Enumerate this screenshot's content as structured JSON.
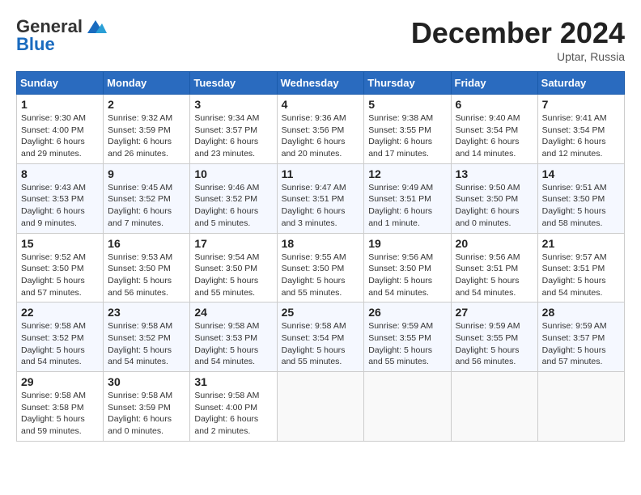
{
  "header": {
    "logo_general": "General",
    "logo_blue": "Blue",
    "month_title": "December 2024",
    "location": "Uptar, Russia"
  },
  "days_of_week": [
    "Sunday",
    "Monday",
    "Tuesday",
    "Wednesday",
    "Thursday",
    "Friday",
    "Saturday"
  ],
  "weeks": [
    [
      {
        "day": "1",
        "detail": "Sunrise: 9:30 AM\nSunset: 4:00 PM\nDaylight: 6 hours\nand 29 minutes."
      },
      {
        "day": "2",
        "detail": "Sunrise: 9:32 AM\nSunset: 3:59 PM\nDaylight: 6 hours\nand 26 minutes."
      },
      {
        "day": "3",
        "detail": "Sunrise: 9:34 AM\nSunset: 3:57 PM\nDaylight: 6 hours\nand 23 minutes."
      },
      {
        "day": "4",
        "detail": "Sunrise: 9:36 AM\nSunset: 3:56 PM\nDaylight: 6 hours\nand 20 minutes."
      },
      {
        "day": "5",
        "detail": "Sunrise: 9:38 AM\nSunset: 3:55 PM\nDaylight: 6 hours\nand 17 minutes."
      },
      {
        "day": "6",
        "detail": "Sunrise: 9:40 AM\nSunset: 3:54 PM\nDaylight: 6 hours\nand 14 minutes."
      },
      {
        "day": "7",
        "detail": "Sunrise: 9:41 AM\nSunset: 3:54 PM\nDaylight: 6 hours\nand 12 minutes."
      }
    ],
    [
      {
        "day": "8",
        "detail": "Sunrise: 9:43 AM\nSunset: 3:53 PM\nDaylight: 6 hours\nand 9 minutes."
      },
      {
        "day": "9",
        "detail": "Sunrise: 9:45 AM\nSunset: 3:52 PM\nDaylight: 6 hours\nand 7 minutes."
      },
      {
        "day": "10",
        "detail": "Sunrise: 9:46 AM\nSunset: 3:52 PM\nDaylight: 6 hours\nand 5 minutes."
      },
      {
        "day": "11",
        "detail": "Sunrise: 9:47 AM\nSunset: 3:51 PM\nDaylight: 6 hours\nand 3 minutes."
      },
      {
        "day": "12",
        "detail": "Sunrise: 9:49 AM\nSunset: 3:51 PM\nDaylight: 6 hours\nand 1 minute."
      },
      {
        "day": "13",
        "detail": "Sunrise: 9:50 AM\nSunset: 3:50 PM\nDaylight: 6 hours\nand 0 minutes."
      },
      {
        "day": "14",
        "detail": "Sunrise: 9:51 AM\nSunset: 3:50 PM\nDaylight: 5 hours\nand 58 minutes."
      }
    ],
    [
      {
        "day": "15",
        "detail": "Sunrise: 9:52 AM\nSunset: 3:50 PM\nDaylight: 5 hours\nand 57 minutes."
      },
      {
        "day": "16",
        "detail": "Sunrise: 9:53 AM\nSunset: 3:50 PM\nDaylight: 5 hours\nand 56 minutes."
      },
      {
        "day": "17",
        "detail": "Sunrise: 9:54 AM\nSunset: 3:50 PM\nDaylight: 5 hours\nand 55 minutes."
      },
      {
        "day": "18",
        "detail": "Sunrise: 9:55 AM\nSunset: 3:50 PM\nDaylight: 5 hours\nand 55 minutes."
      },
      {
        "day": "19",
        "detail": "Sunrise: 9:56 AM\nSunset: 3:50 PM\nDaylight: 5 hours\nand 54 minutes."
      },
      {
        "day": "20",
        "detail": "Sunrise: 9:56 AM\nSunset: 3:51 PM\nDaylight: 5 hours\nand 54 minutes."
      },
      {
        "day": "21",
        "detail": "Sunrise: 9:57 AM\nSunset: 3:51 PM\nDaylight: 5 hours\nand 54 minutes."
      }
    ],
    [
      {
        "day": "22",
        "detail": "Sunrise: 9:58 AM\nSunset: 3:52 PM\nDaylight: 5 hours\nand 54 minutes."
      },
      {
        "day": "23",
        "detail": "Sunrise: 9:58 AM\nSunset: 3:52 PM\nDaylight: 5 hours\nand 54 minutes."
      },
      {
        "day": "24",
        "detail": "Sunrise: 9:58 AM\nSunset: 3:53 PM\nDaylight: 5 hours\nand 54 minutes."
      },
      {
        "day": "25",
        "detail": "Sunrise: 9:58 AM\nSunset: 3:54 PM\nDaylight: 5 hours\nand 55 minutes."
      },
      {
        "day": "26",
        "detail": "Sunrise: 9:59 AM\nSunset: 3:55 PM\nDaylight: 5 hours\nand 55 minutes."
      },
      {
        "day": "27",
        "detail": "Sunrise: 9:59 AM\nSunset: 3:55 PM\nDaylight: 5 hours\nand 56 minutes."
      },
      {
        "day": "28",
        "detail": "Sunrise: 9:59 AM\nSunset: 3:57 PM\nDaylight: 5 hours\nand 57 minutes."
      }
    ],
    [
      {
        "day": "29",
        "detail": "Sunrise: 9:58 AM\nSunset: 3:58 PM\nDaylight: 5 hours\nand 59 minutes."
      },
      {
        "day": "30",
        "detail": "Sunrise: 9:58 AM\nSunset: 3:59 PM\nDaylight: 6 hours\nand 0 minutes."
      },
      {
        "day": "31",
        "detail": "Sunrise: 9:58 AM\nSunset: 4:00 PM\nDaylight: 6 hours\nand 2 minutes."
      },
      {
        "day": "",
        "detail": ""
      },
      {
        "day": "",
        "detail": ""
      },
      {
        "day": "",
        "detail": ""
      },
      {
        "day": "",
        "detail": ""
      }
    ]
  ]
}
